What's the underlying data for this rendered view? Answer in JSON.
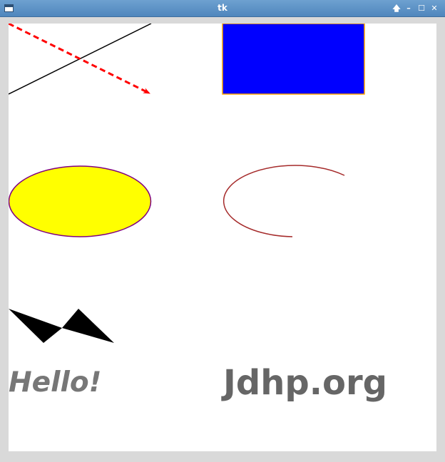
{
  "window": {
    "title": "tk",
    "controls": {
      "raise": "🡅",
      "minimize": "–",
      "maximize": "☐",
      "close": "✕"
    }
  },
  "canvas": {
    "background": "#ffffff",
    "text_hello": "Hello!",
    "text_brand": "Jdhp.org",
    "colors": {
      "line": "#000000",
      "dashed_arrow": "#ff0000",
      "rect_fill": "#0000ff",
      "rect_outline": "#ffa500",
      "oval_fill": "#ffff00",
      "oval_outline": "#800080",
      "arc": "#a52a2a",
      "polygon": "#000000",
      "hello_text": "#777777",
      "brand_text": "#666666"
    }
  }
}
